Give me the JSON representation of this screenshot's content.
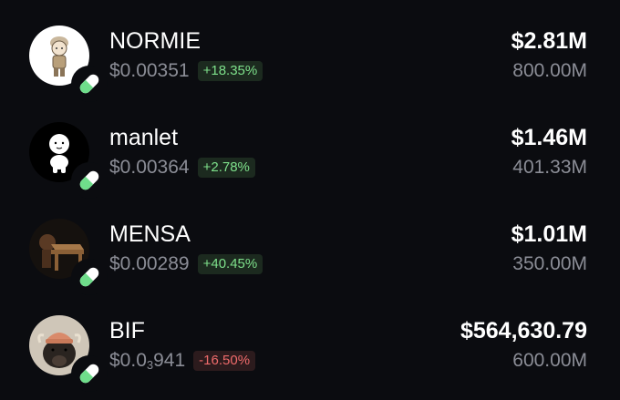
{
  "colors": {
    "background": "#0b0c10",
    "primary_text": "#ffffff",
    "secondary_text": "#8b8d96",
    "positive": "#7ee08b",
    "negative": "#ef6b6b",
    "pill_green": "#6fdd8b"
  },
  "tokens": [
    {
      "name": "NORMIE",
      "price": "$0.00351",
      "change": "+18.35%",
      "change_direction": "up",
      "market_cap": "$2.81M",
      "supply": "800.00M",
      "avatar_icon": "normie-avatar-icon",
      "badge_icon": "pill-icon"
    },
    {
      "name": "manlet",
      "price": "$0.00364",
      "change": "+2.78%",
      "change_direction": "up",
      "market_cap": "$1.46M",
      "supply": "401.33M",
      "avatar_icon": "manlet-avatar-icon",
      "badge_icon": "pill-icon"
    },
    {
      "name": "MENSA",
      "price": "$0.00289",
      "change": "+40.45%",
      "change_direction": "up",
      "market_cap": "$1.01M",
      "supply": "350.00M",
      "avatar_icon": "mensa-avatar-icon",
      "badge_icon": "pill-icon"
    },
    {
      "name": "BIF",
      "price_prefix": "$0.0",
      "price_subscript": "3",
      "price_suffix": "941",
      "change": "-16.50%",
      "change_direction": "down",
      "market_cap": "$564,630.79",
      "supply": "600.00M",
      "avatar_icon": "bif-avatar-icon",
      "badge_icon": "pill-icon"
    }
  ]
}
